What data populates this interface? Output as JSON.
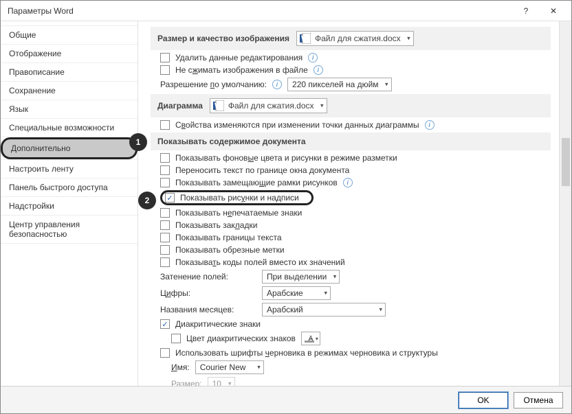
{
  "titlebar": {
    "title": "Параметры Word",
    "help": "?",
    "close": "✕"
  },
  "sidebar": {
    "items": [
      {
        "label": "Общие"
      },
      {
        "label": "Отображение"
      },
      {
        "label": "Правописание"
      },
      {
        "label": "Сохранение"
      },
      {
        "label": "Язык"
      },
      {
        "label": "Специальные возможности"
      },
      {
        "label": "Дополнительно",
        "selected": true
      },
      {
        "label": "Настроить ленту"
      },
      {
        "label": "Панель быстрого доступа"
      },
      {
        "label": "Надстройки"
      },
      {
        "label": "Центр управления безопасностью"
      }
    ]
  },
  "sections": {
    "image": {
      "title": "Размер и качество изображения",
      "doc": "Файл для сжатия.docx",
      "delete_crop": "Удалить данные редактирования",
      "no_compress": "Не сжимать изображения в файле",
      "default_res_label": "Разрешение по умолчанию:",
      "default_res_value": "220 пикселей на дюйм"
    },
    "chart": {
      "title": "Диаграмма",
      "doc": "Файл для сжатия.docx",
      "props_change": "Свойства изменяются при изменении точки данных диаграммы"
    },
    "show": {
      "title": "Показывать содержимое документа",
      "bg_colors": "Показывать фоновые цвета и рисунки в режиме разметки",
      "wrap_window": "Переносить текст по границе окна документа",
      "placeholders": "Показывать замещающие рамки рисунков",
      "drawings": "Показывать рисунки и надписи",
      "nonprinting": "Показывать непечатаемые знаки",
      "bookmarks": "Показывать закладки",
      "text_bounds": "Показывать границы текста",
      "crop_marks": "Показывать обрезные метки",
      "field_codes": "Показывать коды полей вместо их значений",
      "field_shading_label": "Затенение полей:",
      "field_shading_value": "При выделении",
      "numerals_label": "Цифры:",
      "numerals_value": "Арабские",
      "months_label": "Названия месяцев:",
      "months_value": "Арабский",
      "diacritics": "Диакритические знаки",
      "diacritics_color": "Цвет диакритических знаков",
      "draft_font": "Использовать шрифты черновика в режимах черновика и структуры",
      "font_name_label": "Имя:",
      "font_name_value": "Courier New",
      "font_size_label": "Размер:",
      "font_size_value": "10"
    }
  },
  "footer": {
    "ok": "OK",
    "cancel": "Отмена"
  },
  "callouts": {
    "one": "1",
    "two": "2"
  }
}
